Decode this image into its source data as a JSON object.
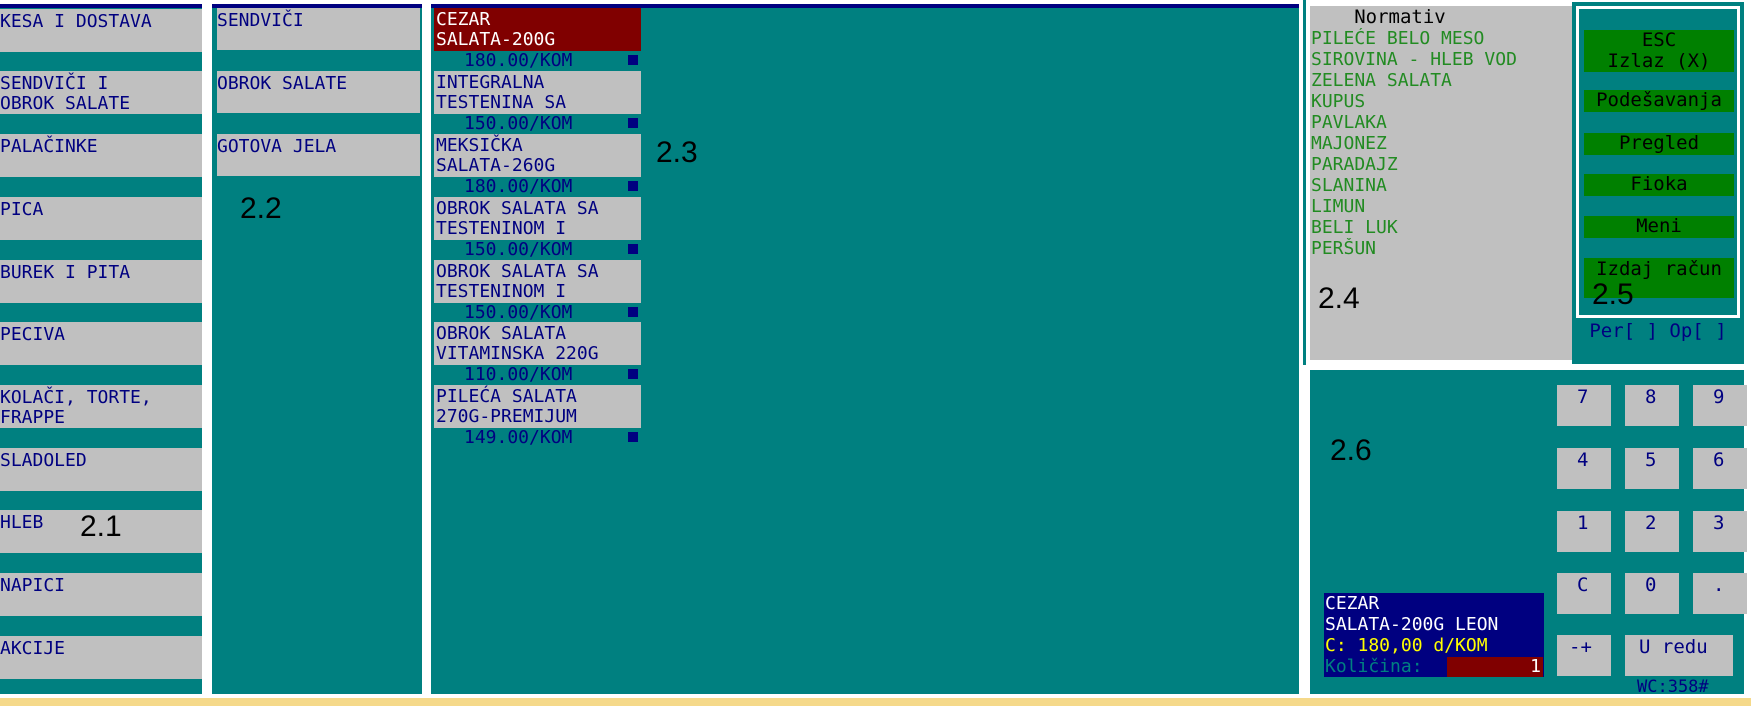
{
  "categories": [
    "KESA I DOSTAVA",
    "SENDVIČI I\nOBROK SALATE",
    "PALAČINKE",
    "PICA",
    "BUREK I PITA",
    "PECIVA",
    "KOLAČI, TORTE,\nFRAPPE",
    "SLADOLED",
    "HLEB",
    "NAPICI",
    "AKCIJE"
  ],
  "subcategories": [
    "SENDVIČI",
    "OBROK SALATE",
    "GOTOVA JELA"
  ],
  "products": [
    {
      "name": "CEZAR\nSALATA-200G",
      "price": "180.00/KOM",
      "selected": true
    },
    {
      "name": "INTEGRALNA\nTESTENINA SA",
      "price": "150.00/KOM",
      "selected": false
    },
    {
      "name": "MEKSIČKA\nSALATA-260G",
      "price": "180.00/KOM",
      "selected": false
    },
    {
      "name": "OBROK SALATA SA\nTESTENINOM I",
      "price": "150.00/KOM",
      "selected": false
    },
    {
      "name": "OBROK SALATA SA\nTESTENINOM I",
      "price": "150.00/KOM",
      "selected": false
    },
    {
      "name": "OBROK SALATA\nVITAMINSKA 220G",
      "price": "110.00/KOM",
      "selected": false
    },
    {
      "name": "PILEĆA SALATA\n270G-PREMIJUM",
      "price": "149.00/KOM",
      "selected": false
    }
  ],
  "normativ": {
    "title": "Normativ",
    "items": [
      "PILEĆE BELO MESO",
      "SIROVINA - HLEB VOD",
      "ZELENA SALATA",
      "KUPUS",
      "PAVLAKA",
      "MAJONEZ",
      "PARADAJZ",
      "SLANINA",
      "LIMUN",
      "BELI LUK",
      "PERŠUN"
    ]
  },
  "functions": {
    "esc": "ESC\nIzlaz (X)",
    "settings": "Podešavanja",
    "review": "Pregled",
    "drawer": "Fioka",
    "menu": "Meni",
    "invoice": "Izdaj račun",
    "status": "Per[ ] Op[ ]"
  },
  "keypad": {
    "k7": "7",
    "k8": "8",
    "k9": "9",
    "k4": "4",
    "k5": "5",
    "k6": "6",
    "k1": "1",
    "k2": "2",
    "k3": "3",
    "kc": "C",
    "k0": "0",
    "kdot": ".",
    "ksign": "-+",
    "kok": "U redu"
  },
  "order": {
    "item_name": "CEZAR\nSALATA-200G LEON",
    "price": "C: 180,00 d/KOM",
    "qty_label": "Količina:",
    "qty_value": "1",
    "wc": "WC:358#"
  },
  "labels": {
    "l21": "2.1",
    "l22": "2.2",
    "l23": "2.3",
    "l24": "2.4",
    "l25": "2.5",
    "l26": "2.6"
  },
  "colors": {
    "panel_bg": "#008080",
    "button_gray": "#c0c0c0",
    "text_navy": "#000080",
    "selected_red": "#800000",
    "func_green": "#008000",
    "norm_green": "#228b22",
    "footer_gold": "#f5d98a"
  }
}
